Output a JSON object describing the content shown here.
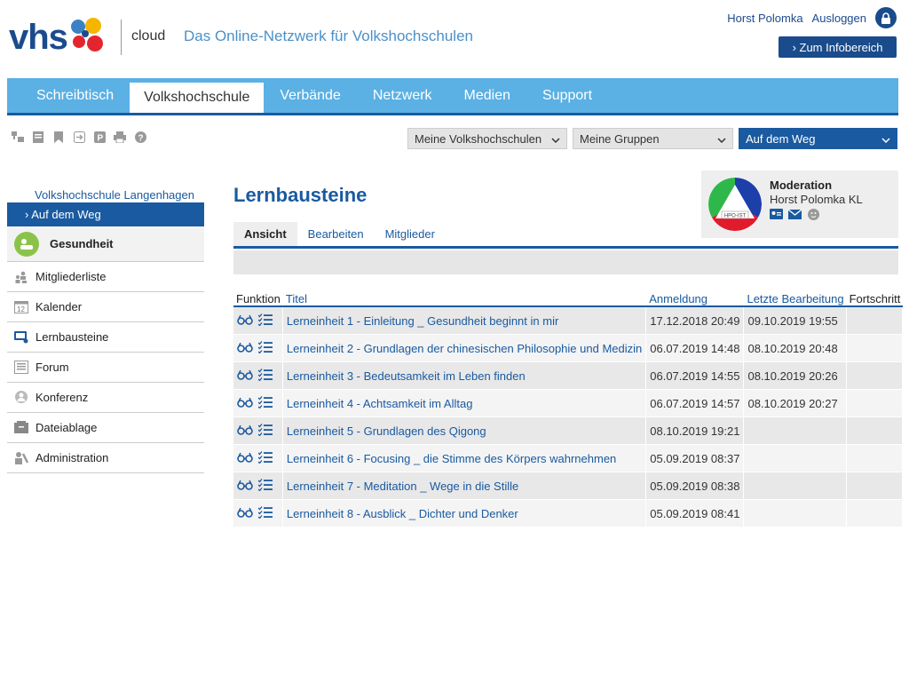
{
  "header": {
    "logo_text": "vhs",
    "cloud_label": "cloud",
    "tagline": "Das Online-Netzwerk für Volkshochschulen",
    "user_name": "Horst Polomka",
    "logout_label": "Ausloggen",
    "info_button": "› Zum Infobereich"
  },
  "nav": {
    "tabs": [
      {
        "label": "Schreibtisch"
      },
      {
        "label": "Volkshochschule"
      },
      {
        "label": "Verbände"
      },
      {
        "label": "Netzwerk"
      },
      {
        "label": "Medien"
      },
      {
        "label": "Support"
      }
    ],
    "active": "Volkshochschule"
  },
  "toolbar": {
    "icons": [
      "structure-icon",
      "note-icon",
      "bookmark-icon",
      "export-icon",
      "parking-icon",
      "print-icon",
      "help-icon"
    ]
  },
  "selects": {
    "vhs": "Meine Volkshochschulen",
    "groups": "Meine Gruppen",
    "current": "Auf dem Weg"
  },
  "sidebar": {
    "parent_link": "Volkshochschule Langenhagen",
    "active_item": "› Auf dem Weg",
    "group_label": "Gesundheit",
    "items": [
      {
        "label": "Mitgliederliste",
        "icon": "members-icon"
      },
      {
        "label": "Kalender",
        "icon": "calendar-icon"
      },
      {
        "label": "Lernbausteine",
        "icon": "learning-icon"
      },
      {
        "label": "Forum",
        "icon": "forum-icon"
      },
      {
        "label": "Konferenz",
        "icon": "conference-icon"
      },
      {
        "label": "Dateiablage",
        "icon": "files-icon"
      },
      {
        "label": "Administration",
        "icon": "admin-icon"
      }
    ]
  },
  "main": {
    "title": "Lernbausteine",
    "moderation": {
      "title": "Moderation",
      "name": "Horst Polomka KL",
      "logo_text": "HPO-IST"
    },
    "subtabs": [
      {
        "label": "Ansicht",
        "active": true
      },
      {
        "label": "Bearbeiten",
        "active": false
      },
      {
        "label": "Mitglieder",
        "active": false
      }
    ],
    "table": {
      "headers": [
        "Funktion",
        "Titel",
        "Anmeldung",
        "Letzte Bearbeitung",
        "Fortschritt"
      ],
      "rows": [
        {
          "title": "Lerneinheit 1 - Einleitung _ Gesundheit beginnt in mir",
          "registered": "17.12.2018 20:49",
          "last_edit": "09.10.2019 19:55",
          "progress": ""
        },
        {
          "title": "Lerneinheit 2 - Grundlagen der chinesischen Philosophie und Medizin",
          "registered": "06.07.2019 14:48",
          "last_edit": "08.10.2019 20:48",
          "progress": ""
        },
        {
          "title": "Lerneinheit 3 - Bedeutsamkeit im Leben finden",
          "registered": "06.07.2019 14:55",
          "last_edit": "08.10.2019 20:26",
          "progress": ""
        },
        {
          "title": "Lerneinheit 4 - Achtsamkeit im Alltag",
          "registered": "06.07.2019 14:57",
          "last_edit": "08.10.2019 20:27",
          "progress": ""
        },
        {
          "title": "Lerneinheit 5 - Grundlagen des Qigong",
          "registered": "08.10.2019 19:21",
          "last_edit": "",
          "progress": ""
        },
        {
          "title": "Lerneinheit 6 - Focusing _ die Stimme des Körpers wahrnehmen",
          "registered": "05.09.2019 08:37",
          "last_edit": "",
          "progress": ""
        },
        {
          "title": "Lerneinheit 7 - Meditation _ Wege in die Stille",
          "registered": "05.09.2019 08:38",
          "last_edit": "",
          "progress": ""
        },
        {
          "title": "Lerneinheit 8 - Ausblick _ Dichter und Denker",
          "registered": "05.09.2019 08:41",
          "last_edit": "",
          "progress": ""
        }
      ]
    }
  },
  "colors": {
    "brand": "#1a4b8c",
    "nav": "#5bb0e4",
    "accent": "#1a5aa0"
  }
}
